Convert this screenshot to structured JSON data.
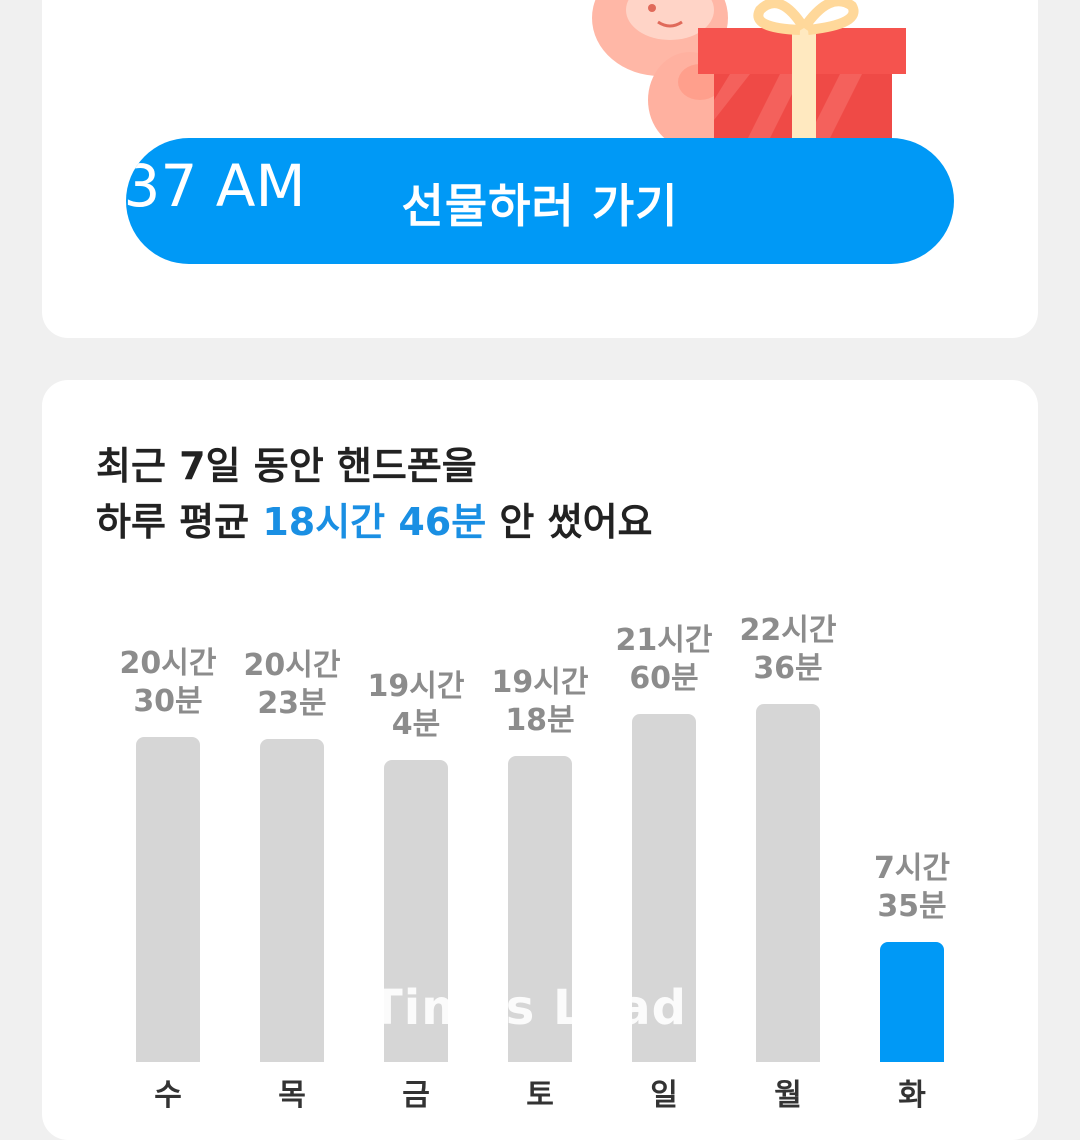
{
  "gift_button": {
    "label": "선물하러 가기",
    "overlay_time": ":37 AM"
  },
  "headline": {
    "line1": "최근 7일 동안 핸드폰을",
    "line2_prefix": "하루 평균 ",
    "line2_highlight": "18시간 46분",
    "line2_suffix": " 안 썼어요"
  },
  "colors": {
    "accent": "#0099f6",
    "highlight_text": "#1a8fe3",
    "bar_inactive": "#d6d6d6",
    "bar_active": "#0099f6"
  },
  "chart_data": {
    "type": "bar",
    "unit": "minutes",
    "categories": [
      "수",
      "목",
      "금",
      "토",
      "일",
      "월",
      "화"
    ],
    "values": [
      1230,
      1223,
      1144,
      1158,
      1320,
      1356,
      455
    ],
    "value_labels": [
      [
        "20시간",
        "30분"
      ],
      [
        "20시간",
        "23분"
      ],
      [
        "19시간",
        "4분"
      ],
      [
        "19시간",
        "18분"
      ],
      [
        "21시간",
        "60분"
      ],
      [
        "22시간",
        "36분"
      ],
      [
        "7시간",
        "35분"
      ]
    ],
    "highlight_index": 6
  },
  "watermark": "Times Lead",
  "illustration": {
    "icon": "gift-box-with-character-icon"
  }
}
